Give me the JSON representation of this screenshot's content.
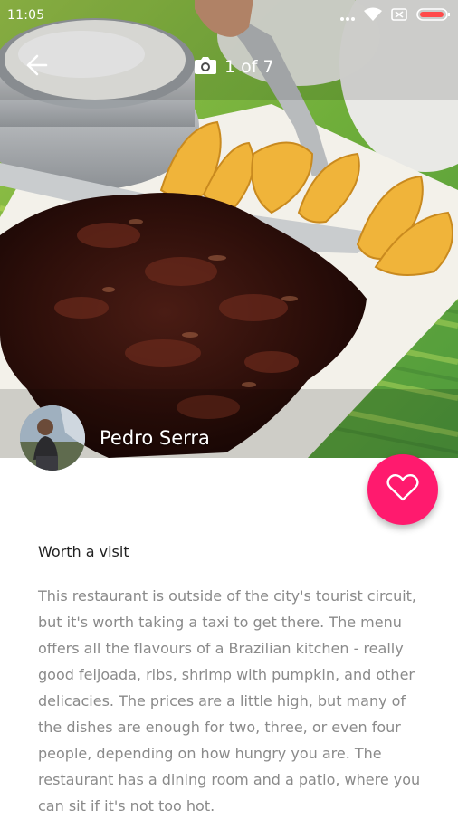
{
  "status_bar": {
    "time": "11:05"
  },
  "photo_viewer": {
    "counter": "1 of 7"
  },
  "review": {
    "author_name": "Pedro Serra",
    "title": "Worth a visit",
    "body": "This restaurant is outside of the city's tourist circuit, but it's worth taking a taxi to get there. The menu offers all the flavours of a Brazilian kitchen - really good feijoada, ribs, shrimp with pumpkin, and other delicacies. The prices are a little high, but many of the dishes are enough for two, three, or even four people, depending on how hungry you are. The restaurant has a dining room and a patio, where you can sit if it's not too hot."
  },
  "colors": {
    "accent": "#ff1a6e",
    "title_text": "#212121",
    "body_text": "#8a8a8a"
  },
  "icons": [
    "back-arrow-icon",
    "camera-icon",
    "heart-icon",
    "wifi-icon",
    "signal-icon",
    "battery-icon"
  ]
}
